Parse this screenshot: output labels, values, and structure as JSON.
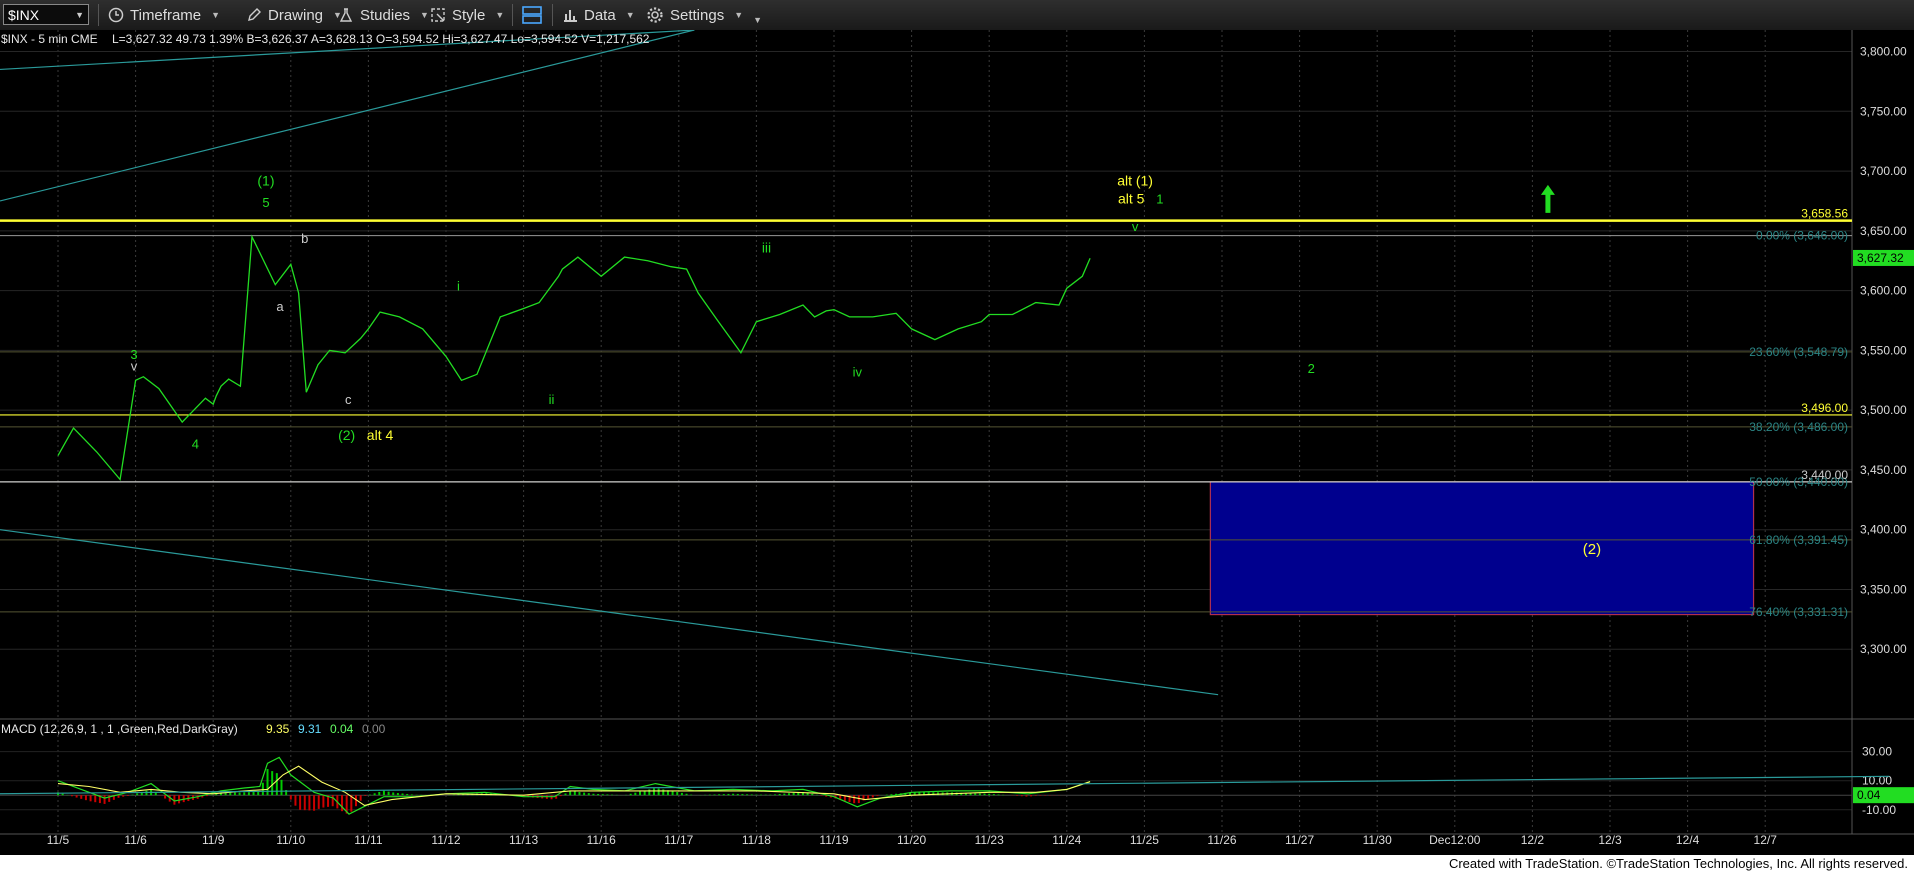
{
  "toolbar": {
    "symbol": "$INX",
    "items": [
      {
        "label": "Timeframe",
        "icon": "clock-icon"
      },
      {
        "label": "Drawing",
        "icon": "pencil-icon"
      },
      {
        "label": "Studies",
        "icon": "flask-icon"
      },
      {
        "label": "Style",
        "icon": "style-icon"
      },
      {
        "label": "",
        "icon": "layout-icon"
      },
      {
        "label": "Data",
        "icon": "bar-chart-icon"
      },
      {
        "label": "Settings",
        "icon": "gear-icon"
      }
    ]
  },
  "header": {
    "title": "$INX - 5 min  CME",
    "stats": "L=3,627.32  49.73  1.39%  B=3,626.37  A=3,628.13  O=3,594.52  Hi=3,627.47  Lo=3,594.52  V=1,217,562"
  },
  "macd_header": {
    "label": "MACD (12,26,9, 1 , 1 ,Green,Red,DarkGray)",
    "v1": "9.35",
    "v2": "9.31",
    "v3": "0.04",
    "v4": "0.00"
  },
  "footer": "Created with TradeStation. ©TradeStation Technologies, Inc. All rights reserved.",
  "colors": {
    "price": "#22dd22",
    "yellow": "#ffff33",
    "teal": "#2a9a9a",
    "fib": "#2b8585",
    "box_fill": "#00008e",
    "box_border": "#b03050",
    "macd_hist_pos": "#00cc00",
    "macd_hist_neg": "#cc0000"
  },
  "chart_data": [
    {
      "type": "line",
      "title": "$INX - 5 min",
      "x_tick_labels": [
        "11/5",
        "11/6",
        "11/9",
        "11/10",
        "11/11",
        "11/12",
        "11/13",
        "11/16",
        "11/17",
        "11/18",
        "11/19",
        "11/20",
        "11/23",
        "11/24",
        "11/25",
        "11/26",
        "11/27",
        "11/30",
        "Dec12:00",
        "12/2",
        "12/3",
        "12/4",
        "12/7"
      ],
      "y_tick_labels": [
        "3,800.00",
        "3,750.00",
        "3,700.00",
        "3,650.00",
        "3,600.00",
        "3,550.00",
        "3,500.00",
        "3,450.00",
        "3,400.00",
        "3,350.00",
        "3,300.00"
      ],
      "ylim": [
        3245,
        3818
      ],
      "y_ticks": [
        3800,
        3750,
        3700,
        3650,
        3600,
        3550,
        3500,
        3450,
        3400,
        3350,
        3300
      ],
      "last_price": 3627.32,
      "last_price_label": "3,627.32",
      "series": [
        {
          "x": [
            0,
            0.2,
            0.5,
            0.8,
            1.0,
            1.1,
            1.3,
            1.6,
            1.9,
            2.0,
            2.04,
            2.1,
            2.2,
            2.35,
            2.5,
            2.8,
            3.0,
            3.1,
            3.2,
            3.35,
            3.5,
            3.7,
            3.9,
            4.0,
            4.15,
            4.4,
            4.7,
            5.0,
            5.2,
            5.4,
            5.7,
            6.0,
            6.2,
            6.45,
            6.5,
            6.7,
            7.0,
            7.3,
            7.6,
            7.9,
            8.1,
            8.25,
            8.5,
            8.8,
            9.0,
            9.3,
            9.6,
            9.75,
            9.9,
            10.0,
            10.2,
            10.5,
            10.8,
            11.0,
            11.3,
            11.6,
            11.9,
            12.0,
            12.3,
            12.6,
            12.9,
            13.0,
            13.2,
            13.3
          ],
          "y": [
            3462,
            3485,
            3465,
            3442,
            3525,
            3528,
            3518,
            3490,
            3510,
            3505,
            3512,
            3520,
            3526,
            3520,
            3645,
            3605,
            3622,
            3598,
            3515,
            3538,
            3550,
            3548,
            3560,
            3568,
            3582,
            3578,
            3568,
            3545,
            3525,
            3530,
            3578,
            3585,
            3590,
            3612,
            3618,
            3628,
            3612,
            3628,
            3625,
            3620,
            3618,
            3598,
            3575,
            3548,
            3574,
            3580,
            3588,
            3578,
            3583,
            3584,
            3578,
            3578,
            3581,
            3568,
            3559,
            3568,
            3574,
            3580,
            3580,
            3590,
            3588,
            3602,
            3612,
            3627
          ]
        }
      ],
      "horizontal_levels": [
        {
          "value": 3658.56,
          "label": "3,658.56",
          "color": "#ffff33"
        },
        {
          "value": 3496.0,
          "label": "3,496.00",
          "color": "#ffff33"
        },
        {
          "value": 3440.0,
          "label": "3,440.00",
          "color": "#cccccc"
        }
      ],
      "fib_levels": [
        {
          "value": 3646.0,
          "label": "0.00% (3,646.00)"
        },
        {
          "value": 3548.79,
          "label": "23.60% (3,548.79)"
        },
        {
          "value": 3486.0,
          "label": "38.20% (3,486.00)"
        },
        {
          "value": 3440.0,
          "label": "50.00% (3,440.00)"
        },
        {
          "value": 3391.45,
          "label": "61.80% (3,391.45)"
        },
        {
          "value": 3331.31,
          "label": "76.40% (3,331.31)"
        }
      ],
      "target_box": {
        "x_from": 14.85,
        "x_to": 21.85,
        "y_from": 3329,
        "y_to": 3440,
        "label": "(2)"
      },
      "trendlines": [
        {
          "x1": 0,
          "y1": 3785,
          "x2": 8.2,
          "y2": 3818
        },
        {
          "x1": 0,
          "y1": 3675,
          "x2": 8.2,
          "y2": 3818
        },
        {
          "x1": 0,
          "y1": 3400,
          "x2": 14.95,
          "y2": 3262
        }
      ],
      "annotations": [
        {
          "text": "(1)",
          "x": 2.68,
          "y": 3688,
          "color": "#22dd22"
        },
        {
          "text": "5",
          "x": 2.68,
          "y": 3670,
          "color": "#22dd22"
        },
        {
          "text": "b",
          "x": 3.18,
          "y": 3640,
          "color": "#cccccc"
        },
        {
          "text": "a",
          "x": 2.86,
          "y": 3583,
          "color": "#cccccc"
        },
        {
          "text": "c",
          "x": 3.74,
          "y": 3505,
          "color": "#cccccc"
        },
        {
          "text": "(2)",
          "x": 3.72,
          "y": 3475,
          "color": "#22dd22"
        },
        {
          "text": "alt 4",
          "x": 4.15,
          "y": 3475,
          "color": "#ffff33"
        },
        {
          "text": "3",
          "x": 0.98,
          "y": 3543,
          "color": "#22dd22"
        },
        {
          "text": "v",
          "x": 0.98,
          "y": 3533,
          "color": "#cccccc"
        },
        {
          "text": "4",
          "x": 1.77,
          "y": 3468,
          "color": "#22dd22"
        },
        {
          "text": "i",
          "x": 5.16,
          "y": 3600,
          "color": "#22dd22"
        },
        {
          "text": "ii",
          "x": 6.36,
          "y": 3505,
          "color": "#22dd22"
        },
        {
          "text": "iii",
          "x": 9.13,
          "y": 3632,
          "color": "#22dd22"
        },
        {
          "text": "iv",
          "x": 10.3,
          "y": 3528,
          "color": "#22dd22"
        },
        {
          "text": "v",
          "x": 13.88,
          "y": 3650,
          "color": "#22dd22"
        },
        {
          "text": "alt (1)",
          "x": 13.88,
          "y": 3688,
          "color": "#ffff33"
        },
        {
          "text": "alt 5",
          "x": 13.83,
          "y": 3673,
          "color": "#ffff33"
        },
        {
          "text": "1",
          "x": 14.2,
          "y": 3673,
          "color": "#22dd22"
        },
        {
          "text": "2",
          "x": 16.15,
          "y": 3531,
          "color": "#22dd22"
        }
      ],
      "up_arrow": {
        "x": 19.2,
        "y": 3670
      }
    },
    {
      "type": "line",
      "title": "MACD (12,26,9, 1 , 1 ,Green,Red,DarkGray)",
      "y_tick_labels": [
        "30.00",
        "10.00",
        "-10.00"
      ],
      "y_ticks": [
        30,
        10,
        -10
      ],
      "ylim": [
        -26,
        38
      ],
      "last_value": 0.04,
      "last_value_label": "0.04",
      "macd": {
        "x": [
          0,
          0.3,
          0.6,
          0.9,
          1.2,
          1.5,
          1.8,
          2.1,
          2.4,
          2.6,
          2.7,
          2.85,
          3.0,
          3.3,
          3.55,
          3.75,
          3.9,
          4.2,
          4.6,
          5.0,
          5.5,
          6.0,
          6.4,
          6.6,
          6.9,
          7.3,
          7.7,
          8.2,
          8.7,
          9.2,
          9.6,
          10.0,
          10.3,
          10.6,
          11.0,
          11.5,
          12.0,
          12.5,
          13.0,
          13.3
        ],
        "values": [
          10,
          4,
          -2,
          2,
          8,
          -4,
          -1,
          3,
          5,
          6,
          22,
          26,
          14,
          2,
          -2,
          -13,
          -9,
          -1,
          -1,
          1,
          2,
          -1,
          -1,
          6,
          4,
          3,
          8,
          3,
          4,
          3,
          4,
          -1,
          -8,
          -2,
          2,
          3,
          3,
          1,
          4,
          9.35
        ]
      },
      "signal": {
        "x": [
          0,
          0.4,
          0.8,
          1.2,
          1.6,
          2.0,
          2.4,
          2.7,
          2.9,
          3.1,
          3.4,
          3.7,
          3.95,
          4.3,
          5.0,
          6.0,
          6.6,
          7.0,
          8.0,
          9.0,
          10.0,
          10.4,
          11.0,
          12.0,
          12.6,
          13.0,
          13.3
        ],
        "values": [
          8,
          6,
          2,
          4,
          2,
          1,
          3,
          4,
          14,
          20,
          9,
          2,
          -7,
          -3,
          1,
          0,
          3,
          3,
          3,
          3,
          1,
          -3,
          0,
          2,
          2,
          4,
          9.31
        ]
      },
      "trendline": {
        "x1": 0,
        "y1": 1,
        "x2": 23.6,
        "y2": 13
      }
    }
  ]
}
